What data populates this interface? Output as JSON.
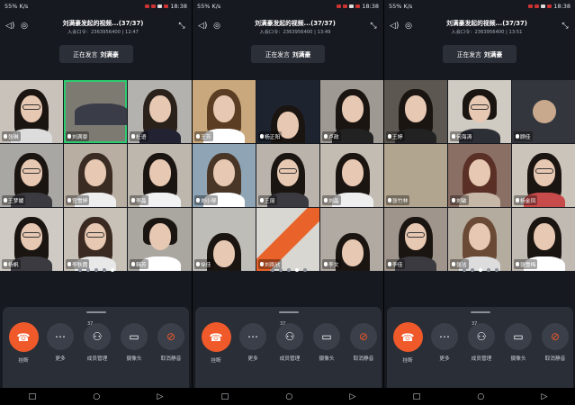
{
  "panels": [
    {
      "status": {
        "time": "18:38",
        "net": "K/s",
        "battery": "55%"
      },
      "meeting": {
        "title": "刘满豪发起的视频...(37/37)",
        "subtitle": "入会口令：2363956400 | 12:47"
      },
      "speaking": {
        "name": "刘满豪",
        "text": "正在发言"
      },
      "tiles": [
        "张琳",
        "刘满豪",
        "杜语",
        "王梦媛",
        "宫雪婷",
        "李晶",
        "杨帆",
        "李秋霞",
        "韩芳"
      ],
      "page_dots": 5,
      "active_dot": 4
    },
    {
      "status": {
        "time": "18:38",
        "net": "K/s",
        "battery": "55%"
      },
      "meeting": {
        "title": "刘满豪发起的视频...(37/37)",
        "subtitle": "入会口令：2363956400 | 13:49"
      },
      "speaking": {
        "name": "刘满豪",
        "text": "正在发言"
      },
      "tiles": [
        "王芳",
        "杨正阳",
        "卢政",
        "刘小琴",
        "王丽",
        "刘晶",
        "徐佳",
        "刘雨欣",
        "李文"
      ],
      "page_dots": 5,
      "active_dot": 3
    },
    {
      "status": {
        "time": "18:38",
        "net": "K/s",
        "battery": "55%"
      },
      "meeting": {
        "title": "刘满豪发起的视频...(37/37)",
        "subtitle": "入会口令：2363956400 | 13:51"
      },
      "speaking": {
        "name": "刘满豪",
        "text": "正在发言"
      },
      "tiles": [
        "王婷",
        "何海涛",
        "顾佳",
        "张竹林",
        "刘敏",
        "杨金凤",
        "李佳",
        "张洁",
        "张雪梅"
      ],
      "page_dots": 5,
      "active_dot": 2
    }
  ],
  "controls": {
    "hangup": "挂断",
    "more": "更多",
    "members": "成员管理",
    "members_count": "37",
    "camera": "摄像头",
    "unmute": "取消静音"
  },
  "icons": [
    "hangup-icon",
    "more-icon",
    "members-icon",
    "camera-icon",
    "mic-off-icon",
    "back-icon",
    "home-icon",
    "recents-icon"
  ],
  "colors": {
    "hangup": "#f05a2b",
    "active_border": "#2ecc71",
    "background": "#16191f",
    "sheet": "#2a2e36"
  }
}
